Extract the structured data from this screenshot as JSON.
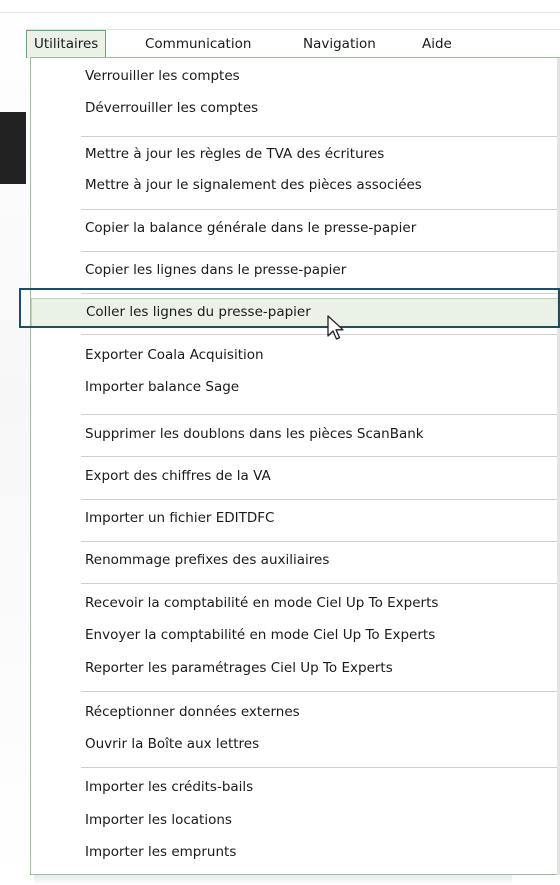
{
  "menubar": {
    "items": [
      {
        "label": "Utilitaires",
        "active": true
      },
      {
        "label": "Communication",
        "active": false
      },
      {
        "label": "Navigation",
        "active": false
      },
      {
        "label": "Aide",
        "active": false
      }
    ]
  },
  "menu": {
    "items": [
      "Verrouiller les comptes",
      "Déverrouiller les comptes",
      "Mettre à jour les règles de TVA des écritures",
      "Mettre à jour le signalement des pièces associées",
      "Copier la balance générale dans le presse-papier",
      "Copier les lignes dans le presse-papier",
      "Coller les lignes du presse-papier",
      "Exporter Coala Acquisition",
      "Importer balance Sage",
      "Supprimer les doublons dans les pièces ScanBank",
      "Export des chiffres de la VA",
      "Importer un fichier EDITDFC",
      "Renommage prefixes des auxiliaires",
      "Recevoir la comptabilité en mode Ciel Up To Experts",
      "Envoyer la comptabilité en mode Ciel Up To Experts",
      "Reporter les paramétrages Ciel Up To Experts",
      "Réceptionner données externes",
      "Ouvrir la Boîte aux lettres",
      "Importer les crédits-bails",
      "Importer les locations",
      "Importer les emprunts"
    ],
    "hovered_index": 6
  },
  "icons": {
    "pointer": "mouse-pointer-icon"
  },
  "colors": {
    "hover_bg": "#eaf2e7",
    "menu_border": "#9cc09a",
    "focus_frame": "#1f4d63"
  }
}
